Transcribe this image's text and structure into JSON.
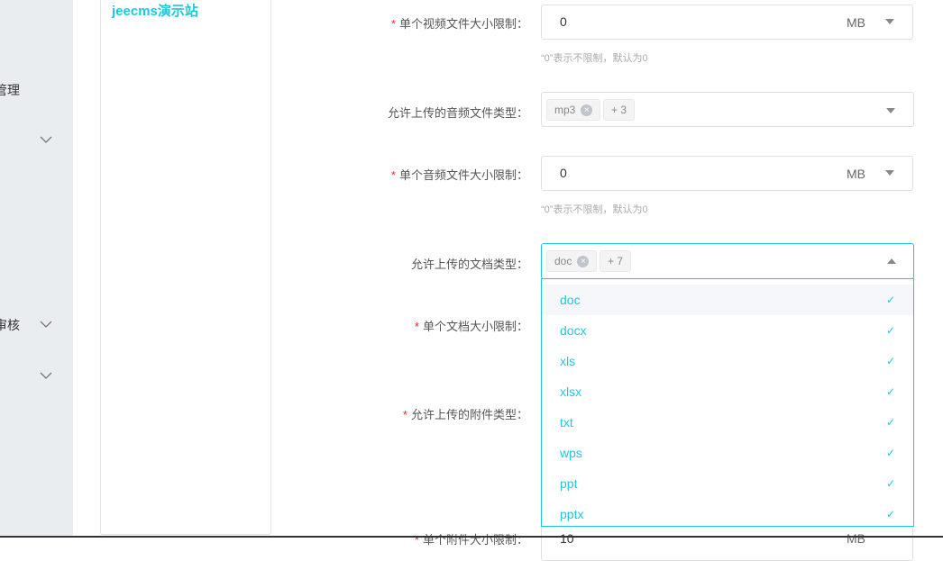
{
  "sidebar": {
    "items": [
      {
        "label": "管理"
      },
      {
        "label": ""
      },
      {
        "label": "审核"
      },
      {
        "label": ""
      }
    ]
  },
  "site": {
    "name": "jeecms演示站"
  },
  "form": {
    "video_size": {
      "label": "单个视频文件大小限制：",
      "value": "0",
      "unit": "MB",
      "hint": "“0”表示不限制，默认为0"
    },
    "audio_types": {
      "label": "允许上传的音频文件类型：",
      "tag": "mp3",
      "more": "+ 3"
    },
    "audio_size": {
      "label": "单个音频文件大小限制：",
      "value": "0",
      "unit": "MB",
      "hint": "“0”表示不限制，默认为0"
    },
    "doc_types": {
      "label": "允许上传的文档类型：",
      "tag": "doc",
      "more": "+ 7",
      "options": [
        "doc",
        "docx",
        "xls",
        "xlsx",
        "txt",
        "wps",
        "ppt",
        "pptx"
      ]
    },
    "doc_size": {
      "label": "单个文档大小限制："
    },
    "attach_types": {
      "label": "允许上传的附件类型："
    },
    "attach_size": {
      "label": "单个附件大小限制：",
      "value": "10",
      "unit": "MB"
    }
  },
  "required_mark": "*",
  "remove_glyph": "×",
  "check_glyph": "✓",
  "colors": {
    "accent": "#1ec8dc",
    "required": "#f5222d"
  }
}
